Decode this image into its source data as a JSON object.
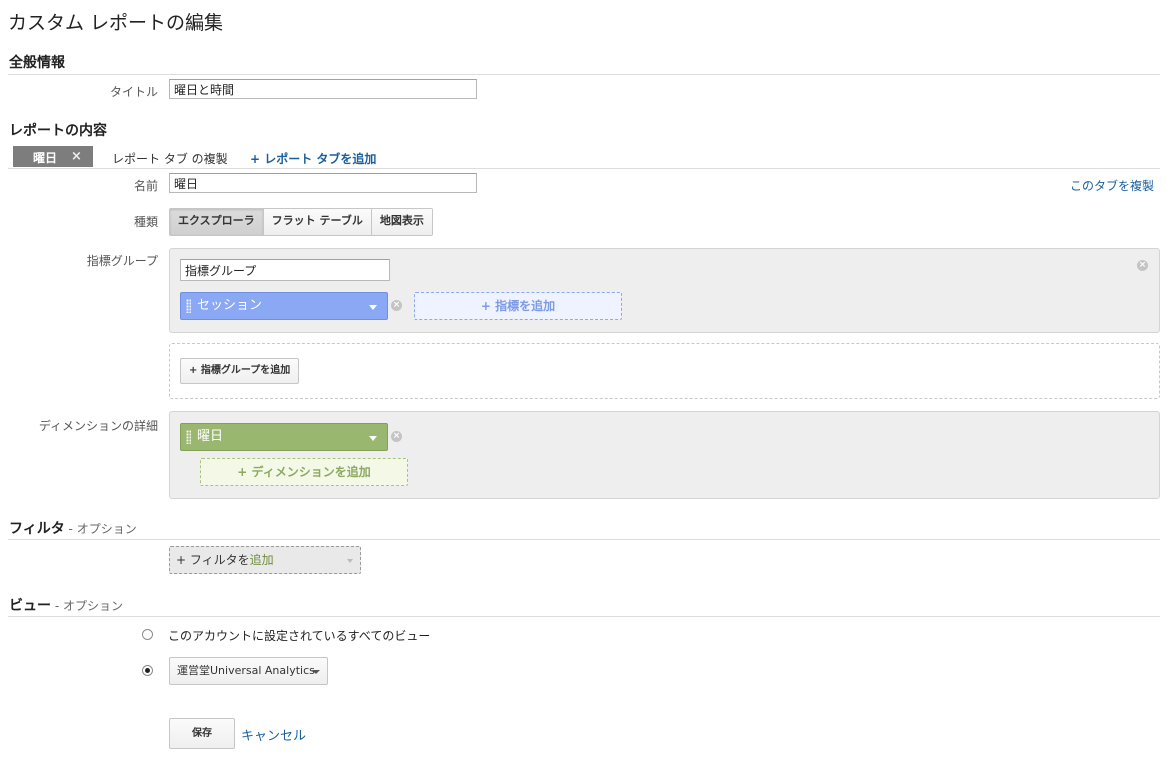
{
  "page": {
    "title": "カスタム レポートの編集"
  },
  "general": {
    "section_title": "全般情報",
    "title_label": "タイトル",
    "title_value": "曜日と時間"
  },
  "content": {
    "section_title": "レポートの内容",
    "active_tab": "曜日",
    "tab_close": "×",
    "duplicate_report_tab": "レポート タブ の複製",
    "add_report_tab": "+ レポート タブを追加",
    "name_label": "名前",
    "name_value": "曜日",
    "duplicate_this_tab": "このタブを複製",
    "type_label": "種類",
    "types": [
      "エクスプローラ",
      "フラット テーブル",
      "地図表示"
    ],
    "metric_group_label": "指標グループ",
    "metric_group_name": "指標グループ",
    "metric_chip": "セッション",
    "add_metric": "+ 指標を追加",
    "add_metric_group": "+ 指標グループを追加",
    "dimension_label": "ディメンションの詳細",
    "dimension_chip": "曜日",
    "add_dimension": "+ ディメンションを追加",
    "remove_glyph": "×"
  },
  "filter": {
    "section_title": "フィルタ",
    "optional": " - オプション",
    "add_filter_prefix": "+ フィルタを",
    "add_filter_suffix": "追加"
  },
  "view": {
    "section_title": "ビュー",
    "optional": " - オプション",
    "all_views": "このアカウントに設定されているすべてのビュー",
    "selected_view": "運営堂Universal Analytics"
  },
  "actions": {
    "save": "保存",
    "cancel": "キャンセル"
  },
  "colors": {
    "metric_chip": "#8aa8f4",
    "dimension_chip": "#9ab770",
    "link": "#1a5f9c"
  }
}
